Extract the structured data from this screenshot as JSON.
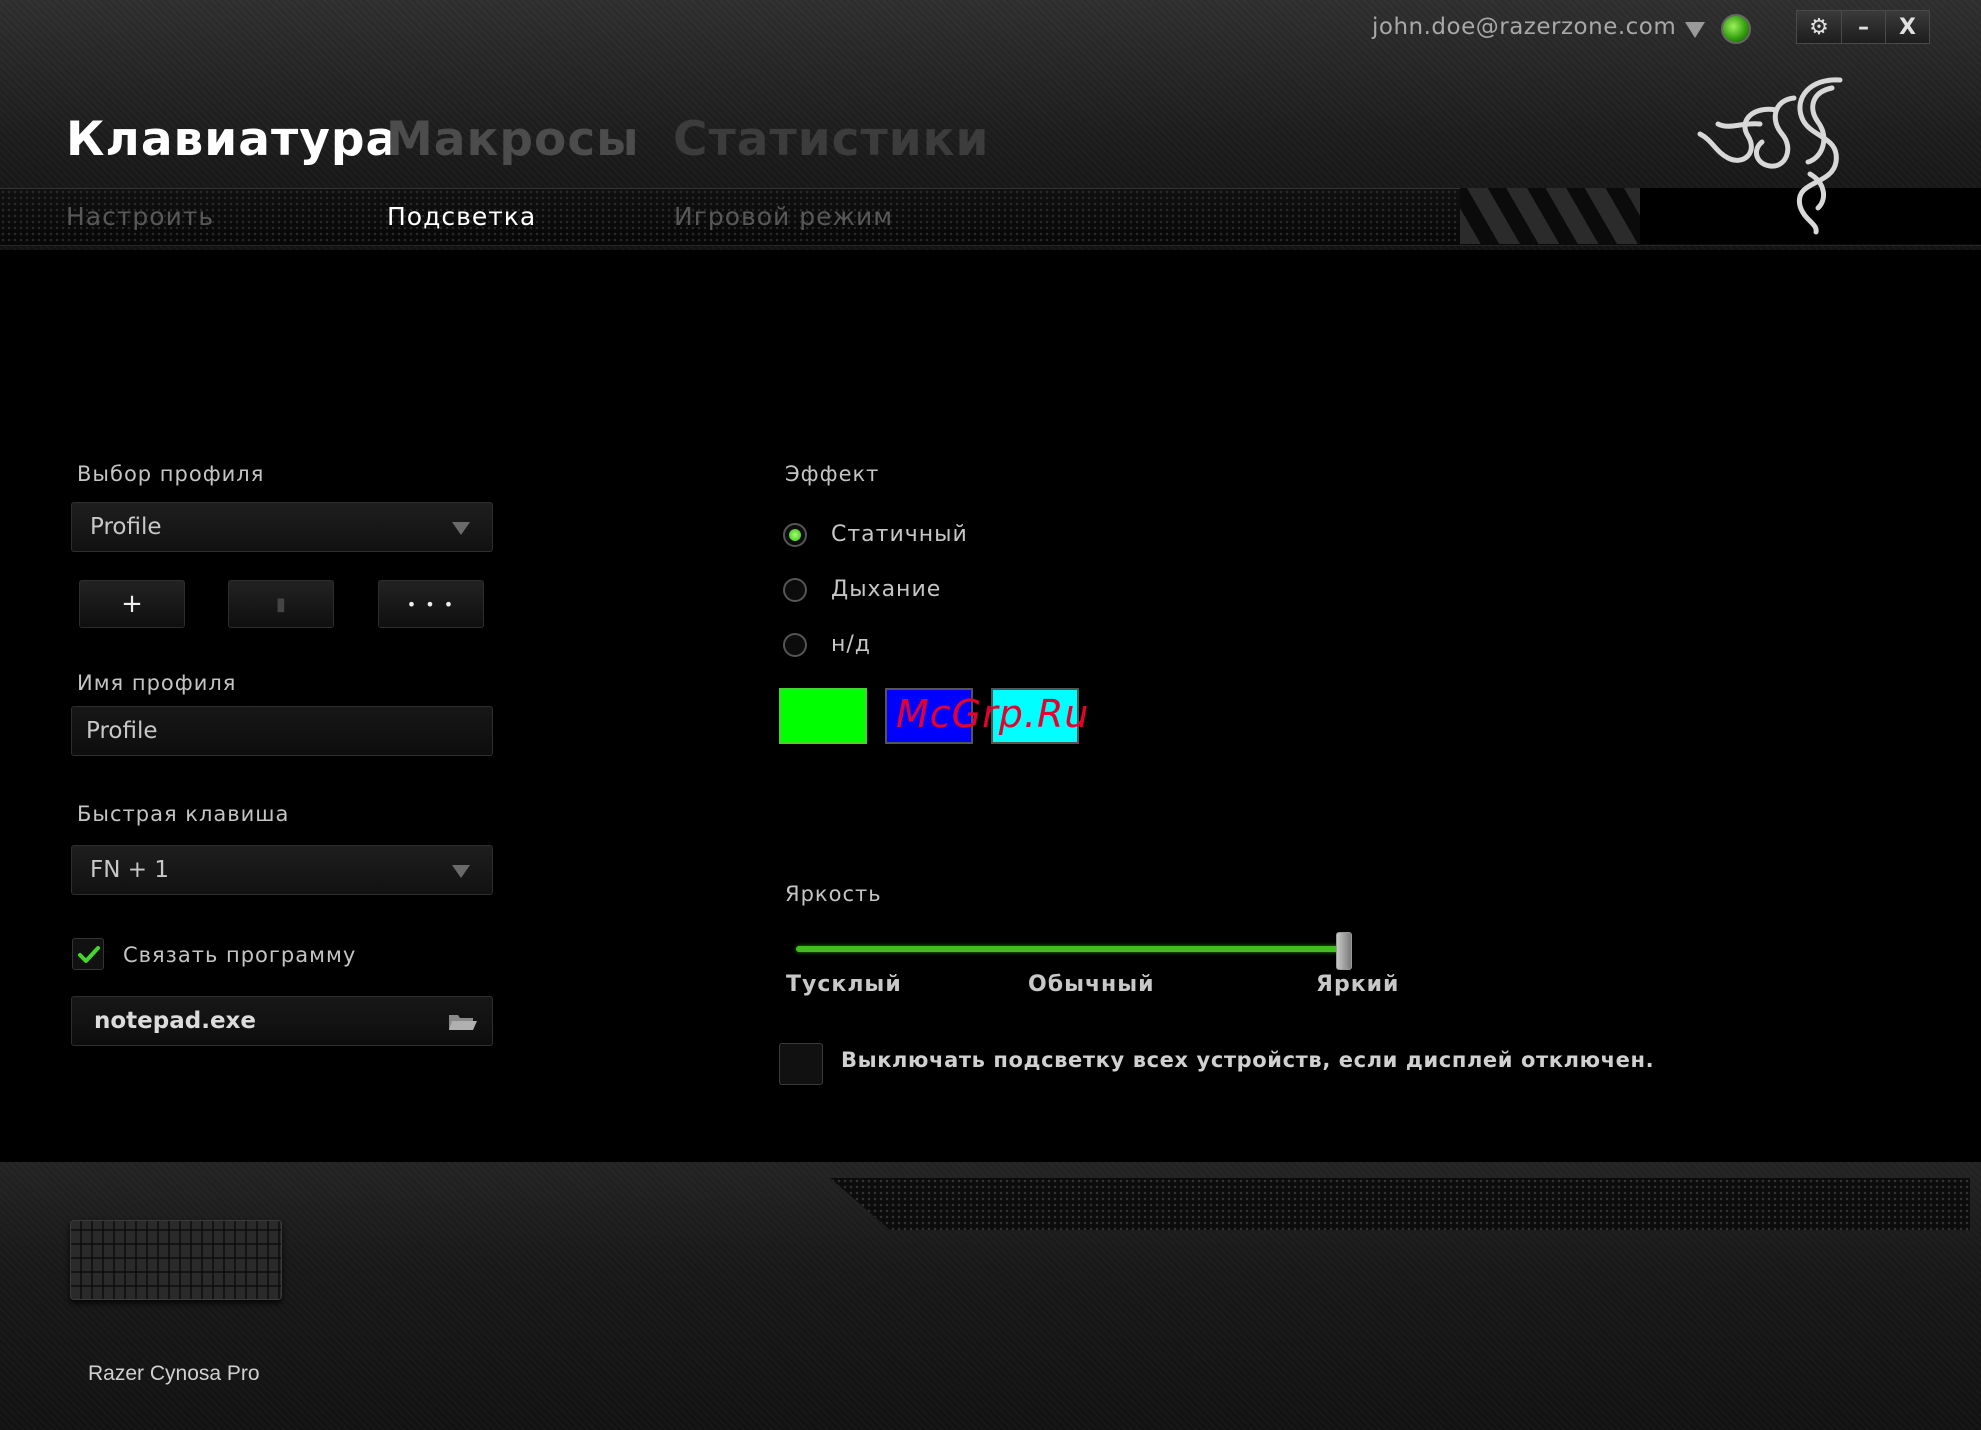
{
  "header": {
    "user_email": "john.doe@razerzone.com",
    "window_buttons": {
      "settings": "⚙",
      "minimize": "–",
      "close": "X"
    },
    "main_tabs": [
      {
        "label": "Клавиатура",
        "active": true
      },
      {
        "label": "Макросы",
        "active": false
      },
      {
        "label": "Статистики",
        "active": false
      }
    ],
    "sub_tabs": [
      {
        "label": "Настроить",
        "active": false
      },
      {
        "label": "Подсветка",
        "active": true
      },
      {
        "label": "Игровой режим",
        "active": false
      }
    ]
  },
  "profile": {
    "select_label": "Выбор профиля",
    "selected_profile": "Profile",
    "buttons": {
      "add": "+",
      "delete": "▮",
      "more": "• • •"
    },
    "name_label": "Имя профиля",
    "name_value": "Profile",
    "hotkey_label": "Быстрая клавиша",
    "hotkey_value": "FN + 1",
    "link_program_label": "Связать программу",
    "link_program_checked": true,
    "program_value": "notepad.exe"
  },
  "effect": {
    "label": "Эффект",
    "options": [
      {
        "label": "Статичный",
        "selected": true
      },
      {
        "label": "Дыхание",
        "selected": false
      },
      {
        "label": "н/д",
        "selected": false
      }
    ],
    "swatches": [
      "#00ff00",
      "#0000ff",
      "#00ffff"
    ],
    "watermark": "McGrp.Ru"
  },
  "brightness": {
    "label": "Яркость",
    "value_fraction": 1.0,
    "ticks": [
      "Тусклый",
      "Обычный",
      "Яркий"
    ]
  },
  "display_off": {
    "label": "Выключать подсветку всех устройств, если дисплей отключен.",
    "checked": false
  },
  "footer": {
    "device_name": "Razer Cynosa Pro"
  },
  "colors": {
    "accent": "#44d62c"
  }
}
